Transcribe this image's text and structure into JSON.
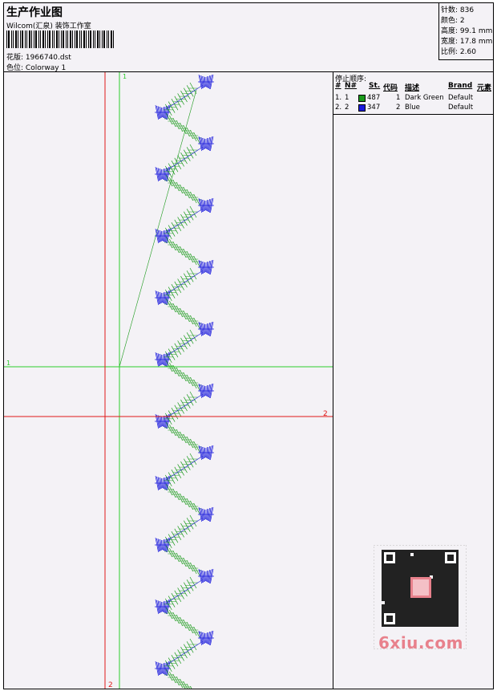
{
  "header": {
    "title": "生产作业图",
    "studio": "Wilcom(汇泉) 装饰工作室",
    "file_label": "花版:",
    "file_name": "1966740.dst",
    "colorway_label": "色位:",
    "colorway": "Colorway 1"
  },
  "stats": [
    {
      "label": "针数:",
      "value": "836"
    },
    {
      "label": "颜色:",
      "value": "2"
    },
    {
      "label": "高度:",
      "value": "99.1 mm"
    },
    {
      "label": "宽度:",
      "value": "17.8 mm"
    },
    {
      "label": "比例:",
      "value": "2.60"
    }
  ],
  "canvas": {
    "green_line_labels": [
      "1",
      "1"
    ],
    "red_line_labels": [
      "2",
      "2"
    ]
  },
  "stop_sequence": {
    "heading": "停止顺序:",
    "columns": [
      "#",
      "N#",
      "St.",
      "代码",
      "描述",
      "Brand",
      "元素"
    ],
    "rows": [
      {
        "index": "1.",
        "n": "1",
        "color": "#1a9a1a",
        "stitches": "487",
        "code": "1",
        "desc": "Dark Green",
        "brand": "Default"
      },
      {
        "index": "2.",
        "n": "2",
        "color": "#1a1adc",
        "stitches": "347",
        "code": "2",
        "desc": "Blue",
        "brand": "Default"
      }
    ]
  },
  "colors": {
    "green_stitch": "#1a9a1a",
    "blue_stitch": "#1a1adc",
    "green_guide": "#2ccd2c",
    "red_guide": "#e01818",
    "watermark": "#e8818c"
  },
  "watermark": {
    "text": "6xiu.com"
  }
}
